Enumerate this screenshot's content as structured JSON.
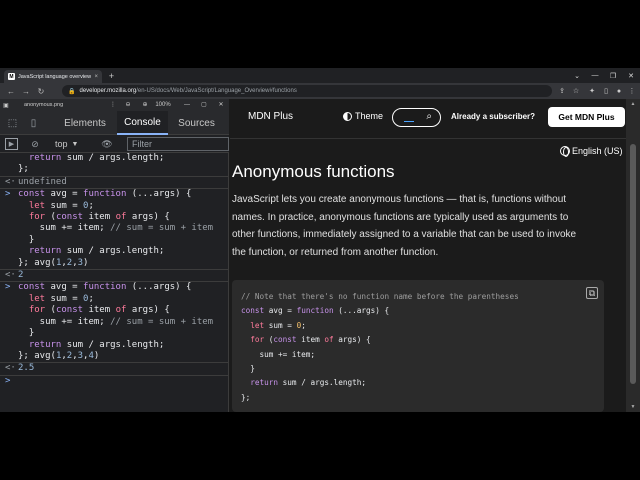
{
  "browser": {
    "tab_title": "JavaScript language overview - J",
    "tab_close": "×",
    "new_tab": "+",
    "win_controls": [
      "⌄",
      "—",
      "❐",
      "✕"
    ],
    "url_host": "developer.mozilla.org",
    "url_path": "/en-US/docs/Web/JavaScript/Language_Overview#functions",
    "nav": {
      "back": "←",
      "forward": "→",
      "reload": "↻"
    }
  },
  "devtools": {
    "file": "anonymous.png",
    "zoom": "100%",
    "tabs": [
      "Elements",
      "Console",
      "Sources"
    ],
    "active_tab": "Console",
    "context": "top",
    "filter_placeholder": "Filter",
    "console_lines": [
      {
        "type": "cont",
        "text": "  return sum / args.length;"
      },
      {
        "type": "cont",
        "text": "};"
      },
      {
        "type": "result",
        "text": "undefined"
      },
      {
        "type": "input",
        "text": "const avg = function (...args) {"
      },
      {
        "type": "cont",
        "text": "  let sum = 0;"
      },
      {
        "type": "cont",
        "text": "  for (const item of args) {"
      },
      {
        "type": "cont",
        "text": "    sum += item; // sum = sum + item"
      },
      {
        "type": "cont",
        "text": "  }"
      },
      {
        "type": "cont",
        "text": "  return sum / args.length;"
      },
      {
        "type": "cont",
        "text": "}; avg(1,2,3)"
      },
      {
        "type": "result",
        "text": "2"
      },
      {
        "type": "input",
        "text": "const avg = function (...args) {"
      },
      {
        "type": "cont",
        "text": "  let sum = 0;"
      },
      {
        "type": "cont",
        "text": "  for (const item of args) {"
      },
      {
        "type": "cont",
        "text": "    sum += item; // sum = sum + item"
      },
      {
        "type": "cont",
        "text": "  }"
      },
      {
        "type": "cont",
        "text": "  return sum / args.length;"
      },
      {
        "type": "cont",
        "text": "}; avg(1,2,3,4)"
      },
      {
        "type": "result",
        "text": "2.5"
      },
      {
        "type": "prompt",
        "text": ""
      }
    ]
  },
  "mdn": {
    "plus": "MDN Plus",
    "theme": "Theme",
    "subscriber": "Already a subscriber?",
    "get_plus": "Get MDN Plus",
    "language": "English (US)",
    "heading": "Anonymous functions",
    "paragraph": "JavaScript lets you create anonymous functions — that is, functions without names. In practice, anonymous functions are typically used as arguments to other functions, immediately assigned to a variable that can be used to invoke the function, or returned from another function.",
    "code_lines": [
      "// Note that there's no function name before the parentheses",
      "const avg = function (...args) {",
      "  let sum = 0;",
      "  for (const item of args) {",
      "    sum += item;",
      "  }",
      "  return sum / args.length;",
      "};"
    ]
  }
}
